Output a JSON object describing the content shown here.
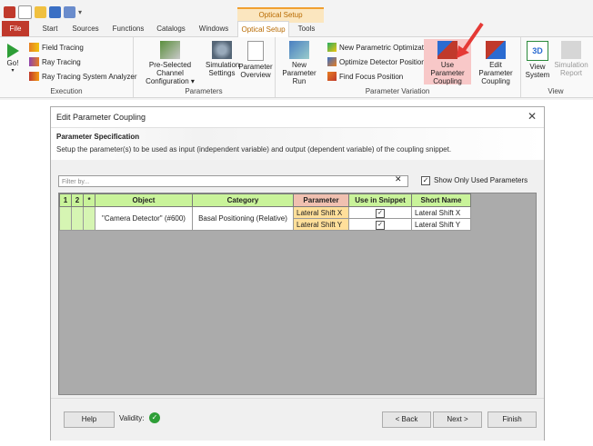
{
  "ribbon": {
    "tabs": [
      "File",
      "Start",
      "Sources",
      "Functions",
      "Catalogs",
      "Windows",
      "Optical Setup",
      "Tools"
    ],
    "context_header": "Optical Setup",
    "execution": {
      "go": "Go!",
      "field_tracing": "Field Tracing",
      "ray_tracing": "Ray Tracing",
      "ray_tracing_analyzer": "Ray Tracing System Analyzer",
      "label": "Execution"
    },
    "parameters": {
      "preselected_line1": "Pre-Selected Channel",
      "preselected_line2": "Configuration",
      "sim_settings_line1": "Simulation",
      "sim_settings_line2": "Settings",
      "param_overview_line1": "Parameter",
      "param_overview_line2": "Overview",
      "label": "Parameters"
    },
    "variation": {
      "new_run_line1": "New",
      "new_run_line2": "Parameter Run",
      "new_opt": "New Parametric Optimization",
      "optimize_detector": "Optimize Detector Positions",
      "find_focus": "Find Focus Position",
      "use_coupling_line1": "Use Parameter",
      "use_coupling_line2": "Coupling",
      "edit_coupling_line1": "Edit Parameter",
      "edit_coupling_line2": "Coupling",
      "label": "Parameter Variation"
    },
    "view": {
      "view_system_line1": "View",
      "view_system_line2": "System",
      "sim_report_line1": "Simulation",
      "sim_report_line2": "Report",
      "label": "View"
    }
  },
  "dialog": {
    "title": "Edit Parameter Coupling",
    "close": "✕",
    "spec_title": "Parameter Specification",
    "spec_desc": "Setup the parameter(s) to be used as input (independent variable) and output (dependent variable) of the coupling snippet.",
    "filter_placeholder": "Filter by...",
    "filter_clear": "✕",
    "show_only_used": "Show Only Used Parameters",
    "columns": [
      "1",
      "2",
      "*",
      "Object",
      "Category",
      "Parameter",
      "Use in Snippet",
      "Short Name"
    ],
    "object": "\"Camera Detector\" (#600)",
    "category": "Basal Positioning (Relative)",
    "rows": [
      {
        "parameter": "Lateral Shift X",
        "use": true,
        "short_name": "Lateral Shift X"
      },
      {
        "parameter": "Lateral Shift Y",
        "use": true,
        "short_name": "Lateral Shift Y"
      }
    ],
    "help": "Help",
    "validity": "Validity:",
    "back": "< Back",
    "next": "Next >",
    "finish": "Finish"
  },
  "colors": {
    "file_tab": "#c0392b",
    "context_accent": "#f0a030",
    "grid_header": "#c9f39a",
    "param_cell": "#ffdf9a",
    "arrow": "#e53935"
  }
}
